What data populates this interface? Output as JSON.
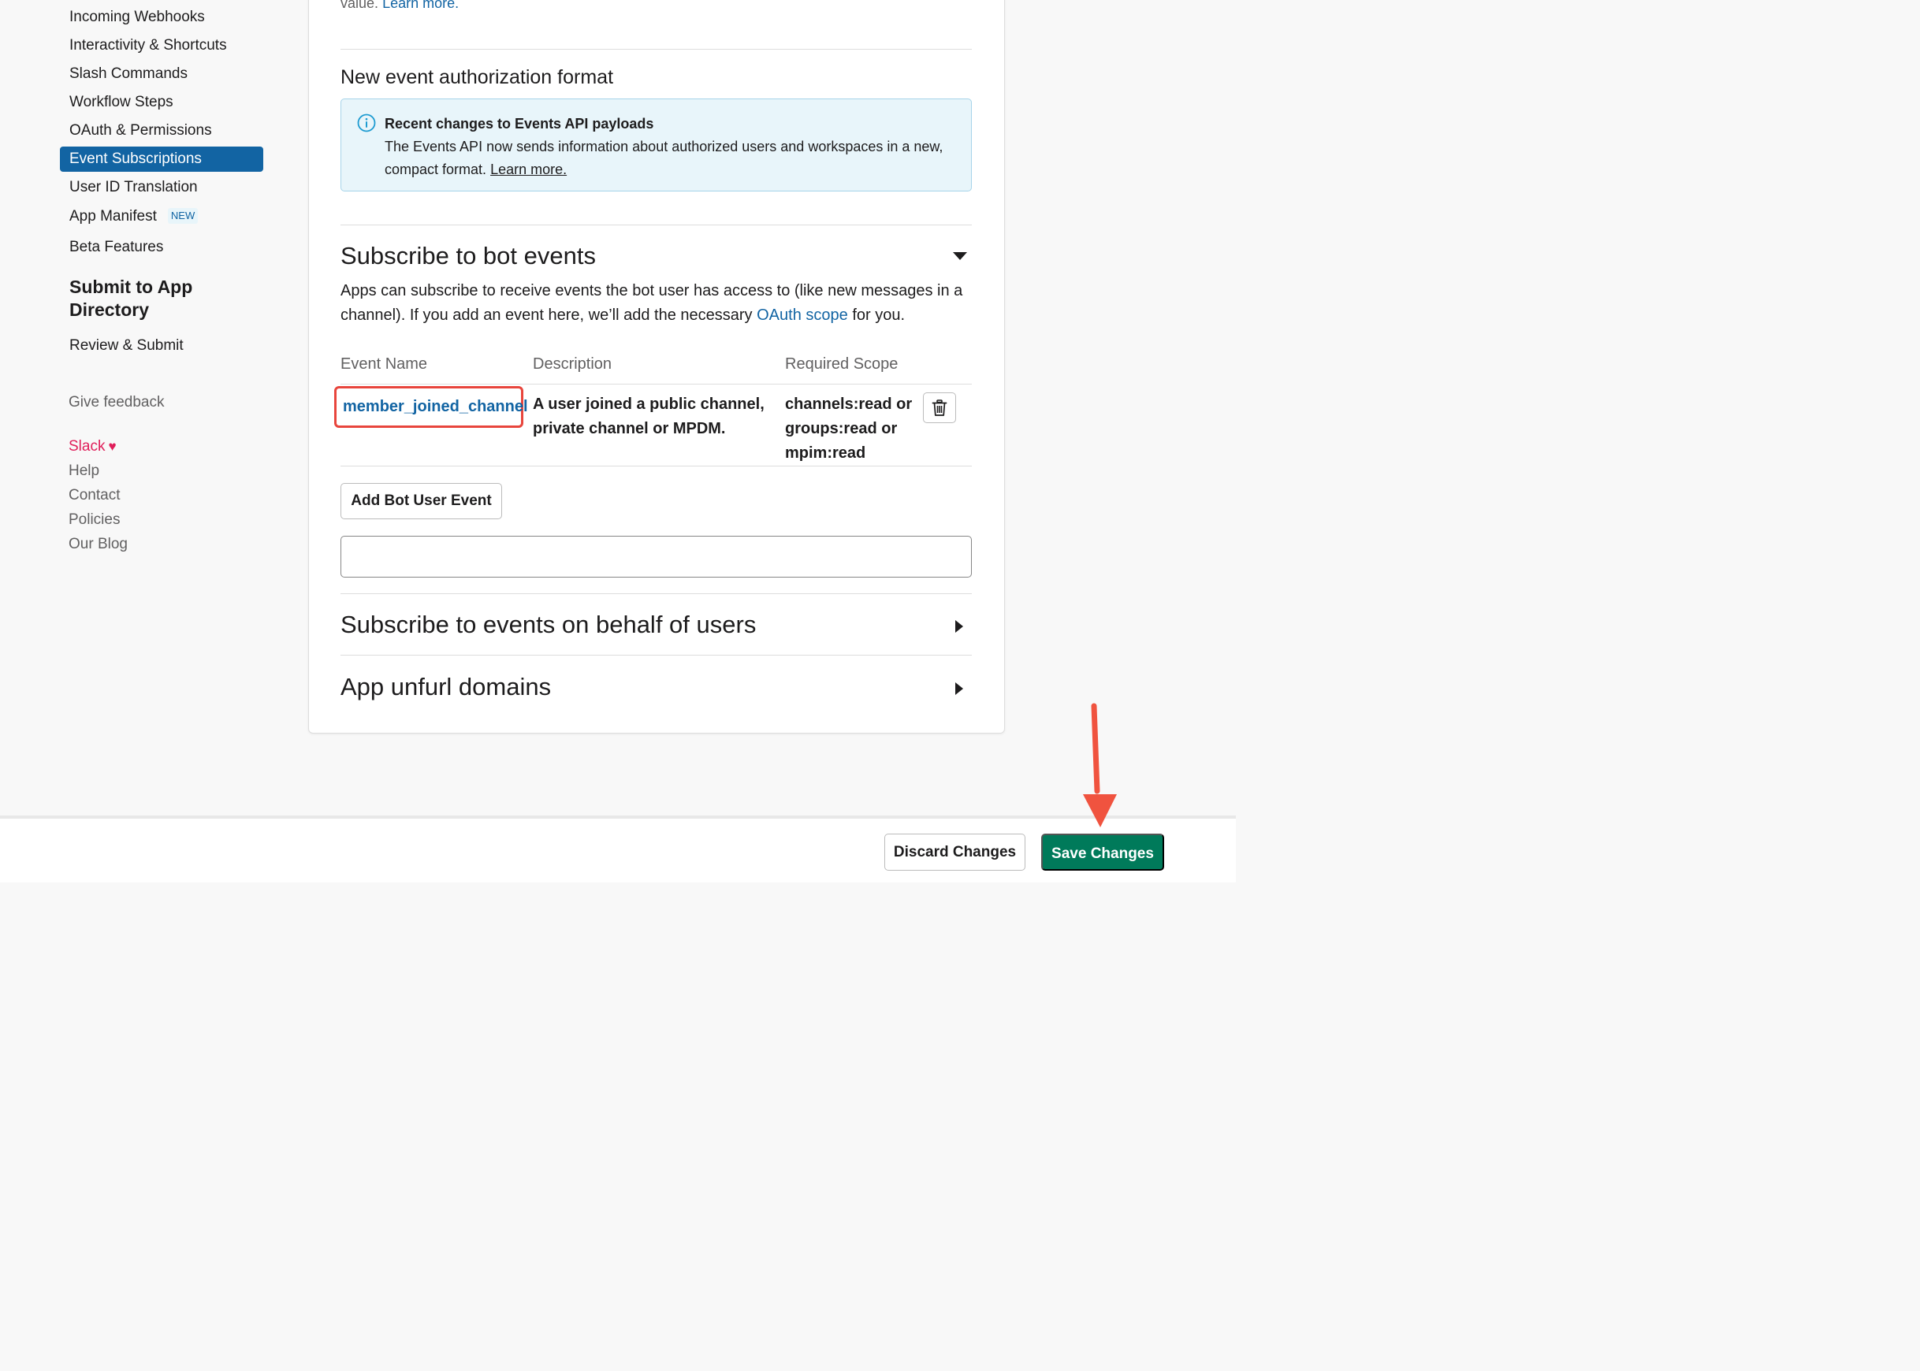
{
  "sidebar": {
    "items": [
      {
        "label": "Incoming Webhooks"
      },
      {
        "label": "Interactivity & Shortcuts"
      },
      {
        "label": "Slash Commands"
      },
      {
        "label": "Workflow Steps"
      },
      {
        "label": "OAuth & Permissions"
      },
      {
        "label": "Event Subscriptions",
        "active": true
      },
      {
        "label": "User ID Translation"
      },
      {
        "label": "App Manifest",
        "badge": "NEW"
      },
      {
        "label": "Beta Features"
      }
    ],
    "section_title": "Submit to App Directory",
    "review_label": "Review & Submit",
    "give_feedback": "Give feedback",
    "footer_links": {
      "slack": "Slack",
      "help": "Help",
      "contact": "Contact",
      "policies": "Policies",
      "blog": "Our Blog"
    }
  },
  "main": {
    "top_text_prefix": "value.",
    "top_learn_more": "Learn more.",
    "auth_format_heading": "New event authorization format",
    "info_banner": {
      "title": "Recent changes to Events API payloads",
      "body": "The Events API now sends information about authorized users and workspaces in a new, compact format.",
      "learn_more": "Learn more."
    },
    "bot_events": {
      "heading": "Subscribe to bot events",
      "desc_part1": "Apps can subscribe to receive events the bot user has access to (like new messages in a channel). If you add an event here, we’ll add the necessary",
      "oauth_scope_link": "OAuth scope",
      "desc_part2": "for you.",
      "columns": [
        "Event Name",
        "Description",
        "Required Scope"
      ],
      "rows": [
        {
          "event_name": "member_joined_channel",
          "description": "A user joined a public channel, private channel or MPDM.",
          "scope_lines": [
            "channels:read or",
            "groups:read or",
            "mpim:read"
          ]
        }
      ],
      "add_button": "Add Bot User Event",
      "input_value": ""
    },
    "user_events_heading": "Subscribe to events on behalf of users",
    "unfurl_heading": "App unfurl domains"
  },
  "footer_bar": {
    "discard_label": "Discard Changes",
    "save_label": "Save Changes"
  },
  "colors": {
    "accent": "#1264a3",
    "save_green": "#007a5a",
    "highlight_red": "#e8453c",
    "info_bg": "#e8f5fa"
  }
}
